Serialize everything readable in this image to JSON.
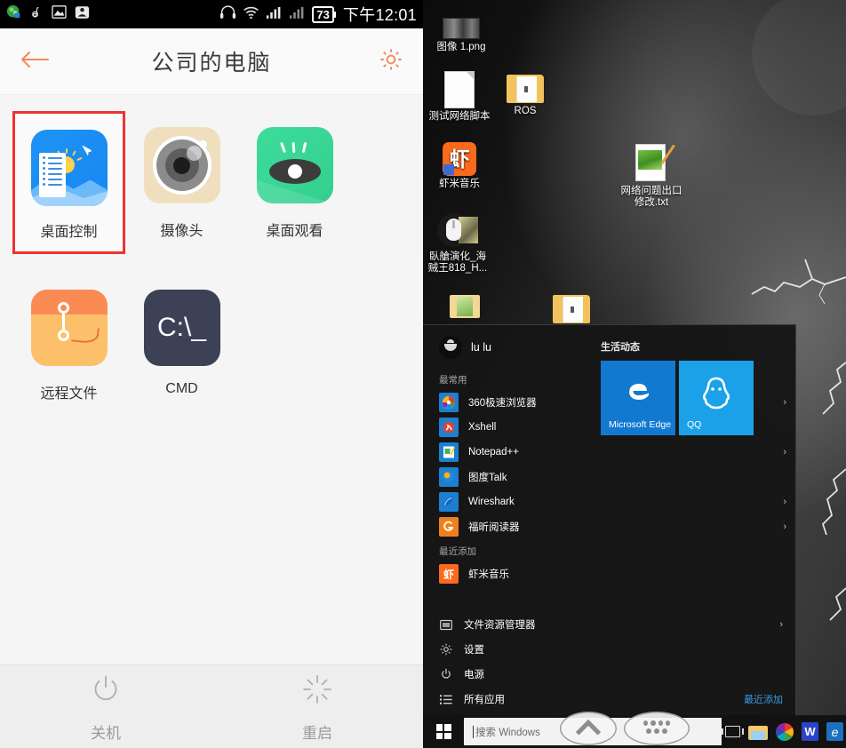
{
  "phone": {
    "statusbar": {
      "left_icons": [
        "browser-app-icon",
        "netease-music-icon",
        "screenshot-icon",
        "download-icon"
      ],
      "headset_icon": "headset-icon",
      "wifi_icon": "wifi-icon",
      "signal1_icon": "signal-bars-icon",
      "signal2_icon": "signal-bars-icon",
      "battery_level": "73",
      "clock": "下午12:01"
    },
    "appbar": {
      "back_icon": "back-arrow-icon",
      "title": "公司的电脑",
      "settings_icon": "gear-icon",
      "accent": "#f08a5d"
    },
    "apps": [
      {
        "id": "desktop-control",
        "label": "桌面控制",
        "selected": true
      },
      {
        "id": "camera",
        "label": "摄像头",
        "selected": false
      },
      {
        "id": "desktop-view",
        "label": "桌面观看",
        "selected": false
      },
      {
        "id": "remote-file",
        "label": "远程文件",
        "selected": false
      },
      {
        "id": "cmd",
        "label": "CMD",
        "selected": false,
        "glyph": "C:\\_"
      }
    ],
    "selection_color": "#ef3232",
    "power_bar": [
      {
        "id": "shutdown",
        "label": "关机",
        "icon": "power-icon"
      },
      {
        "id": "restart",
        "label": "重启",
        "icon": "restart-spinner-icon"
      }
    ]
  },
  "windows": {
    "desktop_icons": [
      {
        "id": "image-1",
        "label": "图像 1.png",
        "icon": "image-thumbnail-icon"
      },
      {
        "id": "network-script",
        "label": "测试网络脚本",
        "icon": "document-icon"
      },
      {
        "id": "ros-folder",
        "label": "ROS",
        "icon": "folder-icon"
      },
      {
        "id": "xiami-music",
        "label": "虾米音乐",
        "icon": "xiami-music-icon"
      },
      {
        "id": "video-file",
        "label": "臥艙演化_海贼王818_H...",
        "icon": "mouse-recorder-icon"
      },
      {
        "id": "network-txt",
        "label": "网络问题出口修改.txt",
        "icon": "text-file-icon"
      }
    ],
    "start_menu": {
      "user": {
        "name": "lu lu",
        "avatar_icon": "user-avatar-icon"
      },
      "sections": [
        {
          "title": "最常用",
          "items": [
            {
              "label": "360极速浏览器",
              "icon": "360-browser-icon",
              "color": "#1d7fd0",
              "glyph": "●",
              "has_chevron": true
            },
            {
              "label": "Xshell",
              "icon": "xshell-icon",
              "color": "#1d7fd0",
              "glyph": "X",
              "has_chevron": false
            },
            {
              "label": "Notepad++",
              "icon": "notepadpp-icon",
              "color": "#1d7fd0",
              "glyph": "✎",
              "has_chevron": true
            },
            {
              "label": "图度Talk",
              "icon": "talk-icon",
              "color": "#1d7fd0",
              "glyph": "✉",
              "has_chevron": false
            },
            {
              "label": "Wireshark",
              "icon": "wireshark-icon",
              "color": "#1d7fd0",
              "glyph": "◢",
              "has_chevron": true
            },
            {
              "label": "福昕阅读器",
              "icon": "foxit-reader-icon",
              "color": "#ef7f1a",
              "glyph": "G",
              "has_chevron": true
            }
          ]
        },
        {
          "title": "最近添加",
          "items": [
            {
              "label": "虾米音乐",
              "icon": "xiami-music-icon",
              "color": "#f96a1d",
              "glyph": "虾",
              "has_chevron": false
            }
          ]
        }
      ],
      "bottom_items": [
        {
          "label": "文件资源管理器",
          "icon": "file-explorer-icon",
          "glyph": "❑",
          "has_chevron": true
        },
        {
          "label": "设置",
          "icon": "settings-gear-icon",
          "glyph": "⚙",
          "has_chevron": false
        },
        {
          "label": "电源",
          "icon": "power-icon",
          "glyph": "⏻",
          "has_chevron": false
        },
        {
          "label": "所有应用",
          "icon": "all-apps-icon",
          "glyph": "☰",
          "has_chevron": false,
          "hint": "最近添加"
        }
      ],
      "tiles": {
        "group_title": "生活动态",
        "items": [
          {
            "label": "Microsoft Edge",
            "glyph": "e",
            "color": "#1279d0",
            "icon": "edge-icon"
          },
          {
            "label": "QQ",
            "glyph": "●",
            "color": "#1ba1e8",
            "icon": "qq-penguin-icon"
          }
        ]
      }
    },
    "taskbar": {
      "start_icon": "windows-logo-icon",
      "search_placeholder": "搜索 Windows",
      "taskview_icon": "task-view-icon",
      "pinned": [
        {
          "id": "explorer",
          "icon": "file-explorer-icon"
        },
        {
          "id": "360",
          "icon": "360-browser-icon"
        },
        {
          "id": "wps",
          "icon": "wps-icon",
          "glyph": "W"
        },
        {
          "id": "edge",
          "icon": "edge-icon",
          "glyph": "e"
        }
      ]
    }
  },
  "overlay_nav": [
    {
      "id": "nav-up",
      "icon": "chevron-up-icon"
    },
    {
      "id": "nav-keys",
      "icon": "keyboard-grid-icon"
    }
  ]
}
